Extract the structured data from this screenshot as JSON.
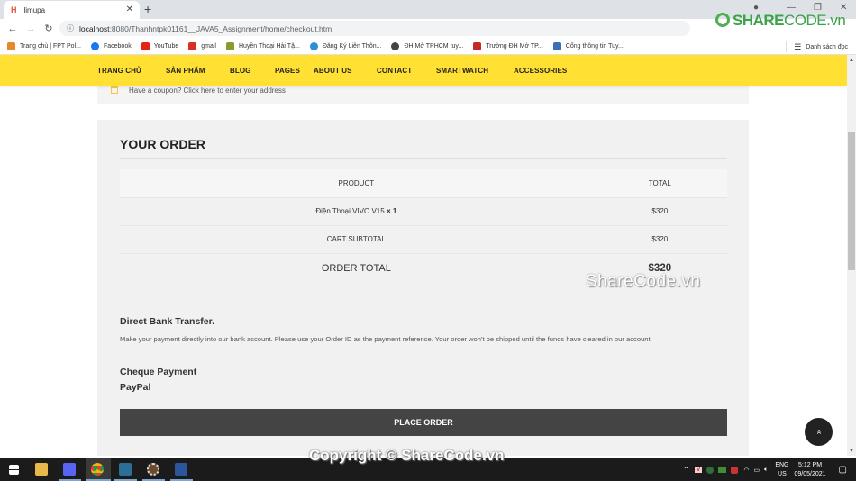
{
  "browser": {
    "tab_title": "limupa",
    "tab_favicon": "H",
    "url_host": "localhost",
    "url_path": ":8080/Thanhntpk01161__JAVA5_Assignment/home/checkout.htm",
    "bookmarks": [
      {
        "label": "Trang chủ | FPT Pol...",
        "icon": "fpt-icon",
        "color": "#e58a2b"
      },
      {
        "label": "Facebook",
        "icon": "facebook-icon",
        "color": "#1877f2"
      },
      {
        "label": "YouTube",
        "icon": "youtube-icon",
        "color": "#e62117"
      },
      {
        "label": "gmail",
        "icon": "gmail-icon",
        "color": "#d93025"
      },
      {
        "label": "Huyền Thoại Hải Tặ...",
        "icon": "game-icon",
        "color": "#8a9a2c"
      },
      {
        "label": "Đăng Ký Liên Thôn...",
        "icon": "globe-icon",
        "color": "#2a8fd6"
      },
      {
        "label": "ĐH Mở TPHCM tuy...",
        "icon": "globe-dark-icon",
        "color": "#444444"
      },
      {
        "label": "Trường ĐH Mở TP...",
        "icon": "ou-icon",
        "color": "#c62828"
      },
      {
        "label": "Cổng thông tin Tuy...",
        "icon": "grad-cap-icon",
        "color": "#3b6fb6"
      }
    ],
    "reading_list": "Danh sách đọc"
  },
  "nav": {
    "items": [
      "TRANG CHỦ",
      "SẢN PHẨM",
      "BLOG",
      "PAGES",
      "ABOUT US",
      "CONTACT",
      "SMARTWATCH",
      "ACCESSORIES"
    ],
    "bg_color": "#ffe033"
  },
  "coupon": {
    "text": "Have a coupon? Click here to enter your address"
  },
  "order": {
    "title": "YOUR ORDER",
    "headers": [
      "PRODUCT",
      "TOTAL"
    ],
    "items": [
      {
        "name": "Điện Thoại VIVO V15",
        "qty": "× 1",
        "total": "$320"
      }
    ],
    "cart_subtotal_label": "CART SUBTOTAL",
    "cart_subtotal": "$320",
    "order_total_label": "ORDER TOTAL",
    "order_total": "$320"
  },
  "payment": {
    "methods": [
      {
        "title": "Direct Bank Transfer.",
        "description": "Make your payment directly into our bank account. Please use your Order ID as the payment reference. Your order won't be shipped until the funds have cleared in our account."
      },
      {
        "title": "Cheque Payment"
      },
      {
        "title": "PayPal"
      }
    ],
    "place_order_label": "PLACE ORDER"
  },
  "back_to_top": "«",
  "watermarks": {
    "logo_share": "SHARE",
    "logo_code": "CODE.vn",
    "middle": "ShareCode.vn",
    "bottom": "Copyright © ShareCode.vn"
  },
  "taskbar": {
    "lang_top": "ENG",
    "lang_bottom": "US",
    "time": "5:12 PM",
    "date": "09/05/2021"
  }
}
